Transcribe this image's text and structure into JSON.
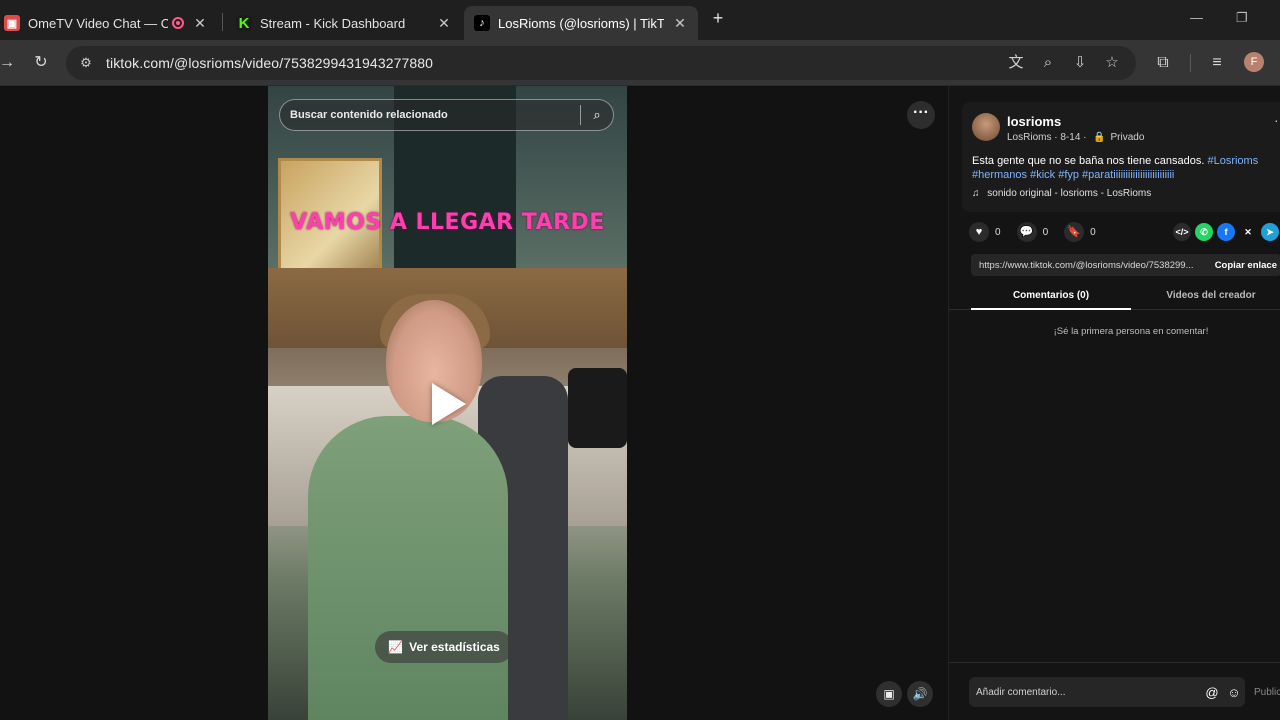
{
  "browser": {
    "tabs": [
      {
        "title": "OmeTV Video Chat — Ome",
        "close": "✕"
      },
      {
        "title": "Stream - Kick Dashboard",
        "close": "✕"
      },
      {
        "title": "LosRioms (@losrioms) | TikTok",
        "close": "✕"
      }
    ],
    "new_tab": "+",
    "url": "tiktok.com/@losrioms/video/7538299431943277880",
    "profile_initial": "F",
    "icons": [
      "back-icon",
      "reload-icon",
      "site-settings-icon",
      "translate-icon",
      "zoom-icon",
      "install-icon",
      "bookmark-star-icon",
      "extensions-icon",
      "media-icon"
    ]
  },
  "video": {
    "search_placeholder": "Buscar contenido relacionado",
    "caption": "VAMOS A LLEGAR TARDE",
    "stats_button": "Ver estadísticas"
  },
  "post": {
    "username": "losrioms",
    "display_name": "LosRioms",
    "date": "8-14",
    "privacy": "Privado",
    "description": "Esta gente que no se baña nos tiene cansados.",
    "hashtags_line1": "#Losrioms",
    "hashtags_line2": "#hermanos #kick #fyp #paratiiiiiiiiiiiiiiiiiiiiiiiii",
    "sound": "sonido original - losrioms - LosRioms",
    "likes": "0",
    "comments": "0",
    "saves": "0",
    "link": "https://www.tiktok.com/@losrioms/video/7538299...",
    "copy_link": "Copiar enlace"
  },
  "panel_tabs": {
    "comments": "Comentarios (0)",
    "creator_videos": "Videos del creador"
  },
  "empty_comments": "¡Sé la primera persona en comentar!",
  "comment_box": {
    "placeholder": "Añadir comentario...",
    "publish": "Publicar"
  }
}
